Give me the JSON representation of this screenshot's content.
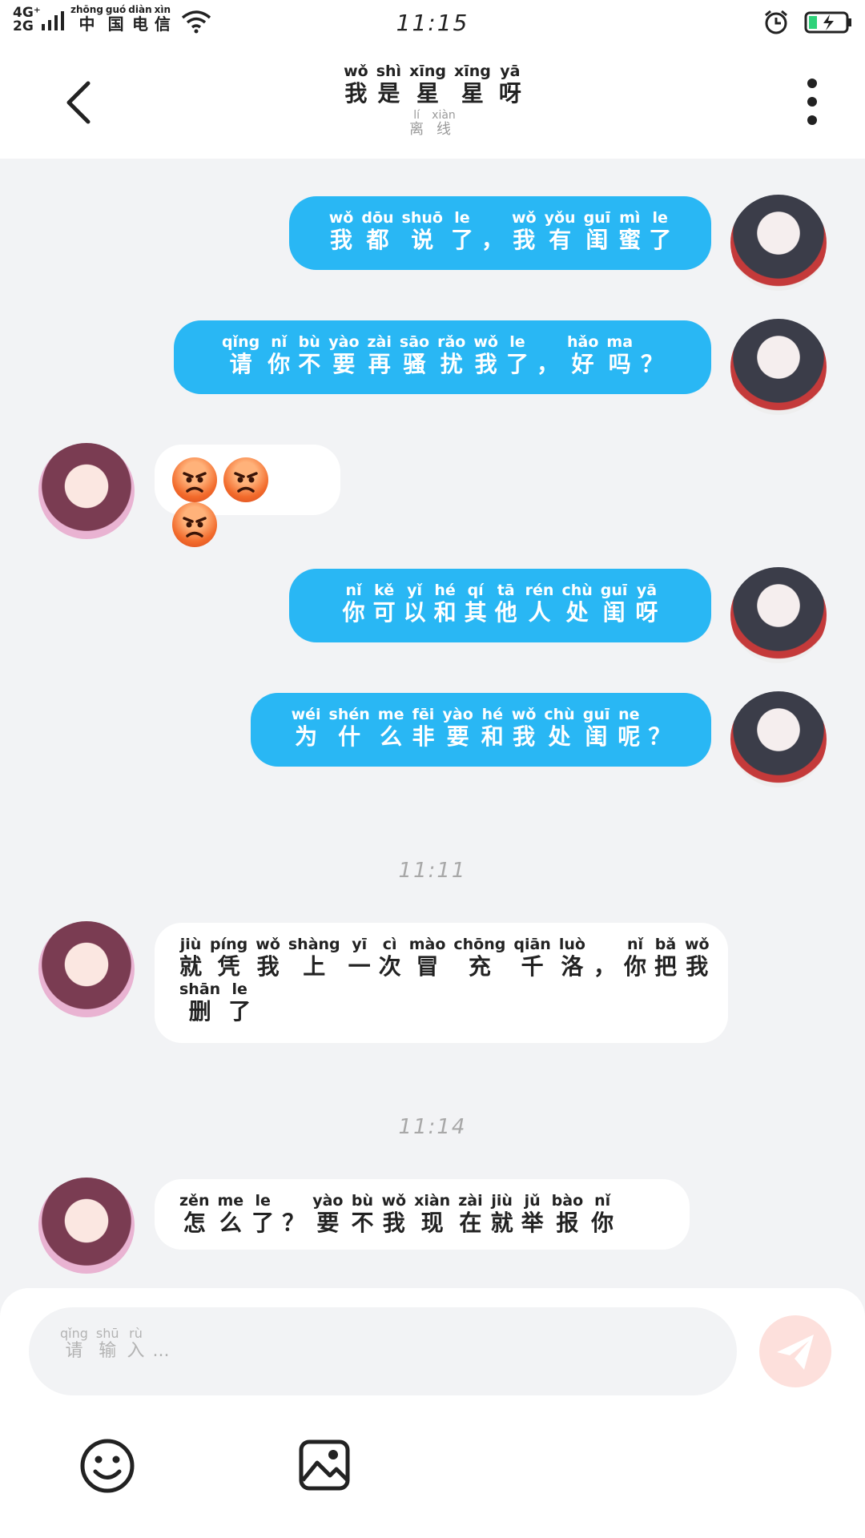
{
  "status_bar": {
    "network_top": "4G⁺",
    "network_bottom": "2G",
    "carrier": [
      {
        "p": "zhōng",
        "c": "中"
      },
      {
        "p": "guó",
        "c": "国"
      },
      {
        "p": "diàn",
        "c": "电"
      },
      {
        "p": "xìn",
        "c": "信"
      }
    ],
    "time": "11:15"
  },
  "header": {
    "title": [
      {
        "p": "wǒ",
        "c": "我"
      },
      {
        "p": "shì",
        "c": "是"
      },
      {
        "p": "xīng",
        "c": "星"
      },
      {
        "p": "xīng",
        "c": "星"
      },
      {
        "p": "yā",
        "c": "呀"
      }
    ],
    "subtitle": [
      {
        "p": "lí",
        "c": "离"
      },
      {
        "p": "xiàn",
        "c": "线"
      }
    ]
  },
  "messages": [
    {
      "side": "out",
      "lines": [
        [
          {
            "p": "wǒ",
            "c": "我"
          },
          {
            "p": "dōu",
            "c": "都"
          },
          {
            "p": "shuō",
            "c": "说"
          },
          {
            "p": "le",
            "c": "了"
          },
          {
            "p": "",
            "c": "，"
          },
          {
            "p": "wǒ",
            "c": "我"
          },
          {
            "p": "yǒu",
            "c": "有"
          },
          {
            "p": "guī",
            "c": "闺"
          },
          {
            "p": "mì",
            "c": "蜜"
          },
          {
            "p": "le",
            "c": "了"
          }
        ]
      ]
    },
    {
      "side": "out",
      "lines": [
        [
          {
            "p": "qǐng",
            "c": "请"
          },
          {
            "p": "nǐ",
            "c": "你"
          },
          {
            "p": "bù",
            "c": "不"
          },
          {
            "p": "yào",
            "c": "要"
          },
          {
            "p": "zài",
            "c": "再"
          },
          {
            "p": "sāo",
            "c": "骚"
          },
          {
            "p": "rǎo",
            "c": "扰"
          },
          {
            "p": "wǒ",
            "c": "我"
          },
          {
            "p": "le",
            "c": "了"
          },
          {
            "p": "",
            "c": "，"
          },
          {
            "p": "hǎo",
            "c": "好"
          },
          {
            "p": "ma",
            "c": "吗"
          },
          {
            "p": "",
            "c": "？"
          }
        ]
      ]
    },
    {
      "side": "in",
      "emoji_count": 3,
      "emoji_name": "angry-face"
    },
    {
      "side": "out",
      "lines": [
        [
          {
            "p": "nǐ",
            "c": "你"
          },
          {
            "p": "kě",
            "c": "可"
          },
          {
            "p": "yǐ",
            "c": "以"
          },
          {
            "p": "hé",
            "c": "和"
          },
          {
            "p": "qí",
            "c": "其"
          },
          {
            "p": "tā",
            "c": "他"
          },
          {
            "p": "rén",
            "c": "人"
          },
          {
            "p": "chù",
            "c": "处"
          },
          {
            "p": "guī",
            "c": "闺"
          },
          {
            "p": "yā",
            "c": "呀"
          }
        ]
      ]
    },
    {
      "side": "out",
      "lines": [
        [
          {
            "p": "wéi",
            "c": "为"
          },
          {
            "p": "shén",
            "c": "什"
          },
          {
            "p": "me",
            "c": "么"
          },
          {
            "p": "fēi",
            "c": "非"
          },
          {
            "p": "yào",
            "c": "要"
          },
          {
            "p": "hé",
            "c": "和"
          },
          {
            "p": "wǒ",
            "c": "我"
          },
          {
            "p": "chù",
            "c": "处"
          },
          {
            "p": "guī",
            "c": "闺"
          },
          {
            "p": "ne",
            "c": "呢"
          },
          {
            "p": "",
            "c": "？"
          }
        ]
      ]
    },
    {
      "type": "time",
      "text": "11:11"
    },
    {
      "side": "in",
      "lines": [
        [
          {
            "p": "jiù",
            "c": "就"
          },
          {
            "p": "píng",
            "c": "凭"
          },
          {
            "p": "wǒ",
            "c": "我"
          },
          {
            "p": "shàng",
            "c": "上"
          },
          {
            "p": "yī",
            "c": "一"
          },
          {
            "p": "cì",
            "c": "次"
          },
          {
            "p": "mào",
            "c": "冒"
          },
          {
            "p": "chōng",
            "c": "充"
          },
          {
            "p": "qiān",
            "c": "千"
          },
          {
            "p": "luò",
            "c": "洛"
          },
          {
            "p": "",
            "c": "，"
          },
          {
            "p": "nǐ",
            "c": "你"
          },
          {
            "p": "bǎ",
            "c": "把"
          },
          {
            "p": "wǒ",
            "c": "我"
          }
        ],
        [
          {
            "p": "shān",
            "c": "删"
          },
          {
            "p": "le",
            "c": "了"
          }
        ]
      ]
    },
    {
      "type": "time",
      "text": "11:14"
    },
    {
      "side": "in",
      "lines": [
        [
          {
            "p": "zěn",
            "c": "怎"
          },
          {
            "p": "me",
            "c": "么"
          },
          {
            "p": "le",
            "c": "了"
          },
          {
            "p": "",
            "c": "？"
          },
          {
            "p": "yào",
            "c": "要"
          },
          {
            "p": "bù",
            "c": "不"
          },
          {
            "p": "wǒ",
            "c": "我"
          },
          {
            "p": "xiàn",
            "c": "现"
          },
          {
            "p": "zài",
            "c": "在"
          },
          {
            "p": "jiù",
            "c": "就"
          },
          {
            "p": "jǔ",
            "c": "举"
          },
          {
            "p": "bào",
            "c": "报"
          },
          {
            "p": "nǐ",
            "c": "你"
          }
        ]
      ]
    }
  ],
  "input": {
    "placeholder": [
      {
        "p": "qǐng",
        "c": "请"
      },
      {
        "p": "shū",
        "c": "输"
      },
      {
        "p": "rù",
        "c": "入"
      },
      {
        "p": "",
        "c": "..."
      }
    ]
  },
  "colors": {
    "outgoing_bubble": "#29b7f4",
    "incoming_bubble": "#ffffff",
    "background": "#f2f3f5",
    "send_button": "#fde0dc"
  },
  "icons": {
    "back": "chevron-left-icon",
    "more": "more-vertical-icon",
    "send": "paper-plane-icon",
    "emoji": "smiley-icon",
    "image": "image-icon"
  }
}
